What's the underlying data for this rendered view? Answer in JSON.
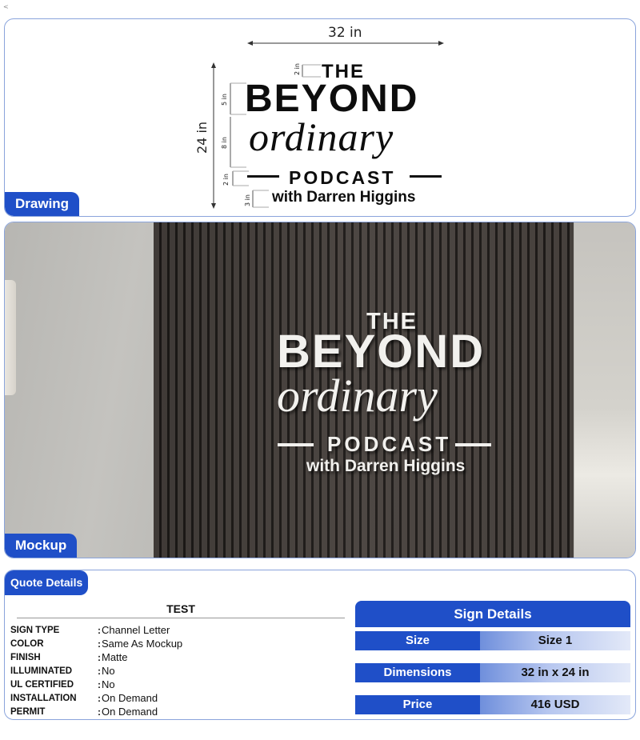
{
  "corner_mark": "<",
  "drawing": {
    "tag": "Drawing",
    "width_label": "32 in",
    "height_label": "24 in",
    "dims": [
      "2 in",
      "5 in",
      "8 in",
      "2 in",
      "3 in"
    ],
    "logo": {
      "line1": "THE",
      "line2": "BEYOND",
      "line3": "ordinary",
      "line4": "PODCAST",
      "line5": "with Darren Higgins"
    }
  },
  "mockup": {
    "tag": "Mockup",
    "logo": {
      "line1": "THE",
      "line2": "BEYOND",
      "line3": "ordinary",
      "line4": "PODCAST",
      "line5": "with Darren Higgins"
    }
  },
  "quote": {
    "tag": "Quote Details",
    "title": "TEST",
    "specs": [
      {
        "label": "SIGN TYPE",
        "value": "Channel Letter"
      },
      {
        "label": "COLOR",
        "value": "Same As Mockup"
      },
      {
        "label": "FINISH",
        "value": "Matte"
      },
      {
        "label": "ILLUMINATED",
        "value": "No"
      },
      {
        "label": "UL CERTIFIED",
        "value": "No"
      },
      {
        "label": "INSTALLATION",
        "value": "On Demand"
      },
      {
        "label": "PERMIT",
        "value": "On Demand"
      }
    ],
    "sign_details": {
      "heading": "Sign Details",
      "rows": [
        {
          "key": "Size",
          "value": "Size 1"
        },
        {
          "key": "Dimensions",
          "value": "32 in x 24 in"
        },
        {
          "key": "Price",
          "value": "416 USD"
        }
      ]
    }
  },
  "colors": {
    "accent": "#1f4fc8",
    "panel_border": "#8aa4dc"
  }
}
